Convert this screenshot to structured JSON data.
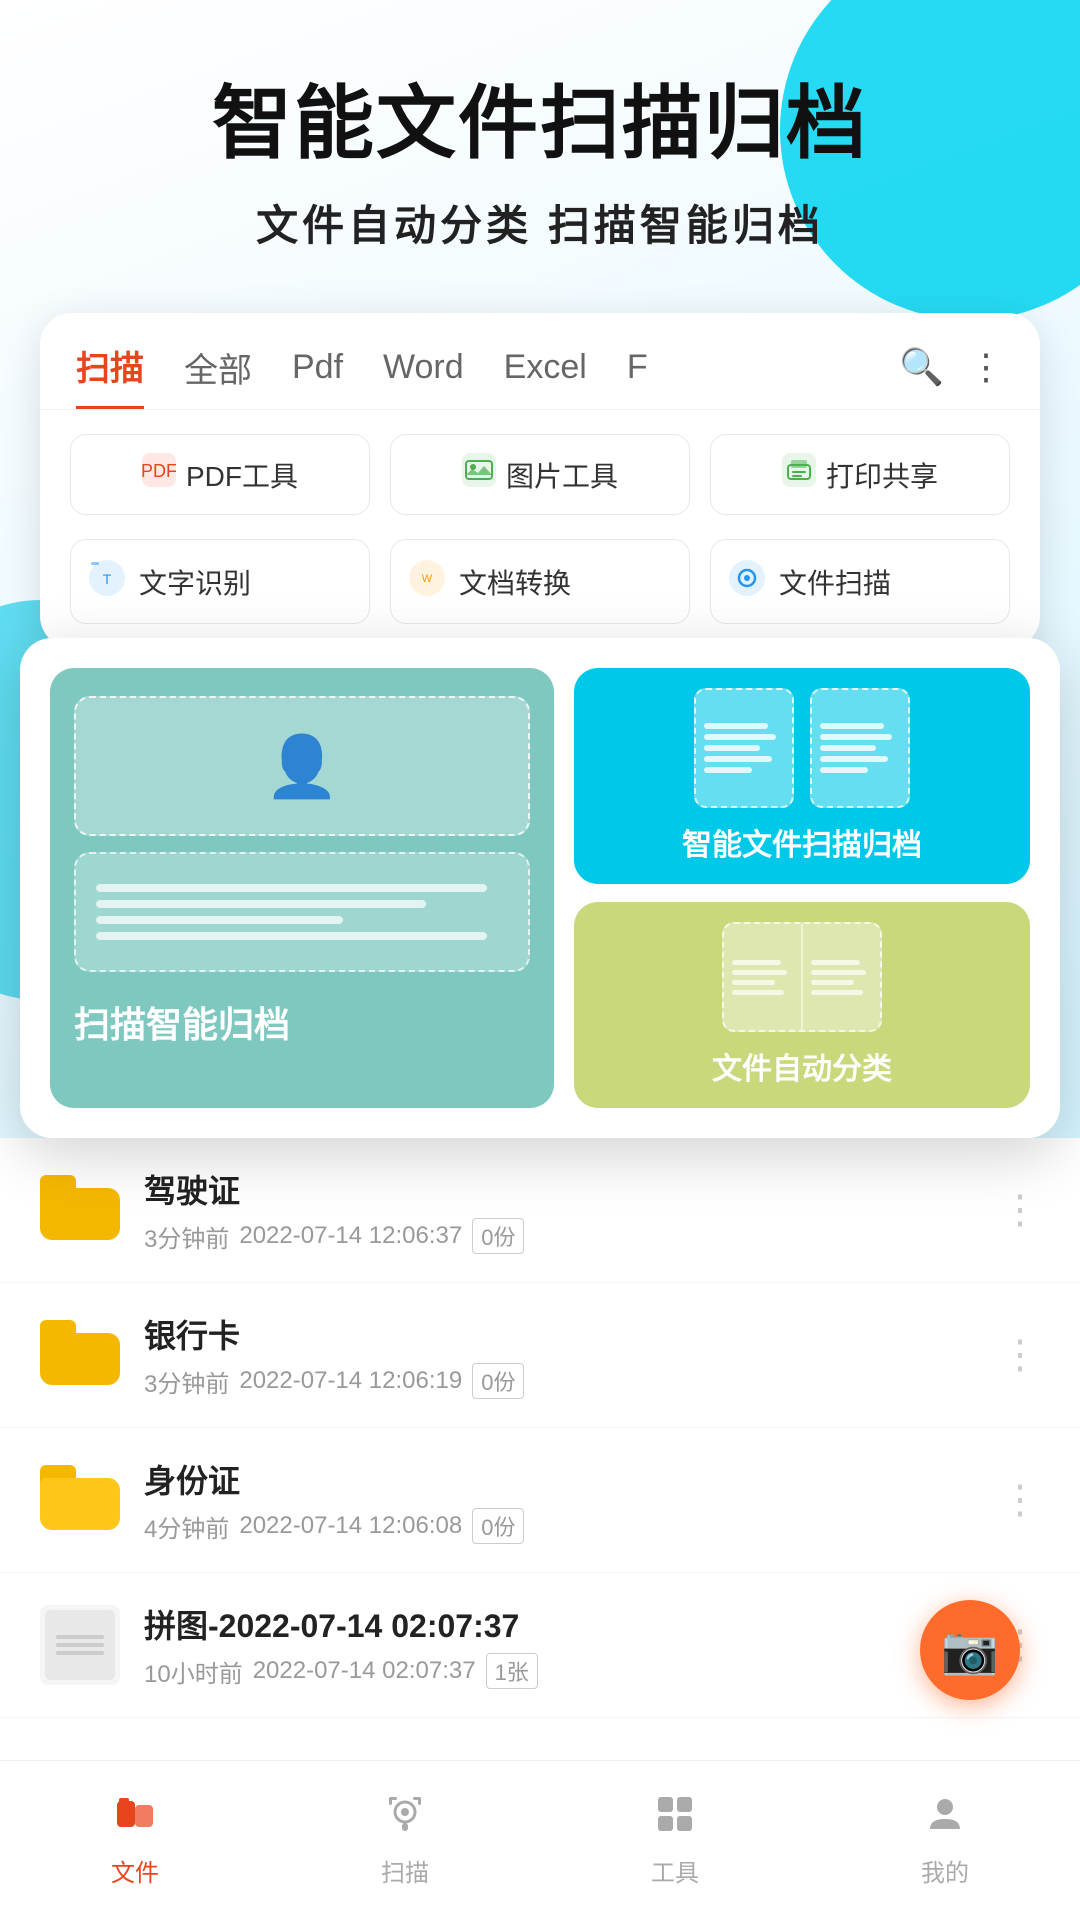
{
  "app": {
    "title": "智能文件扫描归档"
  },
  "hero": {
    "title": "智能文件扫描归档",
    "subtitle": "文件自动分类   扫描智能归档"
  },
  "tabs": {
    "items": [
      {
        "label": "扫描",
        "active": true
      },
      {
        "label": "全部",
        "active": false
      },
      {
        "label": "Pdf",
        "active": false
      },
      {
        "label": "Word",
        "active": false
      },
      {
        "label": "Excel",
        "active": false
      },
      {
        "label": "F",
        "active": false
      }
    ]
  },
  "toolbar": {
    "tools": [
      {
        "label": "PDF工具",
        "icon": "pdf"
      },
      {
        "label": "图片工具",
        "icon": "img"
      },
      {
        "label": "打印共享",
        "icon": "print"
      }
    ],
    "tools2": [
      {
        "label": "文字识别",
        "icon": "txt"
      },
      {
        "label": "文档转换",
        "icon": "doc"
      },
      {
        "label": "文件扫描",
        "icon": "scan"
      }
    ]
  },
  "features": {
    "left": {
      "label": "扫描智能归档"
    },
    "right_top": {
      "label": "智能文件扫描归档"
    },
    "right_bottom": {
      "label": "文件自动分类"
    }
  },
  "files": [
    {
      "name": "驾驶证",
      "time": "3分钟前",
      "date": "2022-07-14 12:06:37",
      "count": "0份",
      "type": "folder"
    },
    {
      "name": "银行卡",
      "time": "3分钟前",
      "date": "2022-07-14 12:06:19",
      "count": "0份",
      "type": "folder"
    },
    {
      "name": "身份证",
      "time": "4分钟前",
      "date": "2022-07-14 12:06:08",
      "count": "0份",
      "type": "folder"
    },
    {
      "name": "拼图-2022-07-14 02:07:37",
      "time": "10小时前",
      "date": "2022-07-14 02:07:37",
      "count": "1张",
      "type": "image"
    }
  ],
  "nav": {
    "items": [
      {
        "label": "文件",
        "active": true,
        "icon": "folder"
      },
      {
        "label": "扫描",
        "active": false,
        "icon": "camera"
      },
      {
        "label": "工具",
        "active": false,
        "icon": "grid"
      },
      {
        "label": "我的",
        "active": false,
        "icon": "person"
      }
    ]
  }
}
